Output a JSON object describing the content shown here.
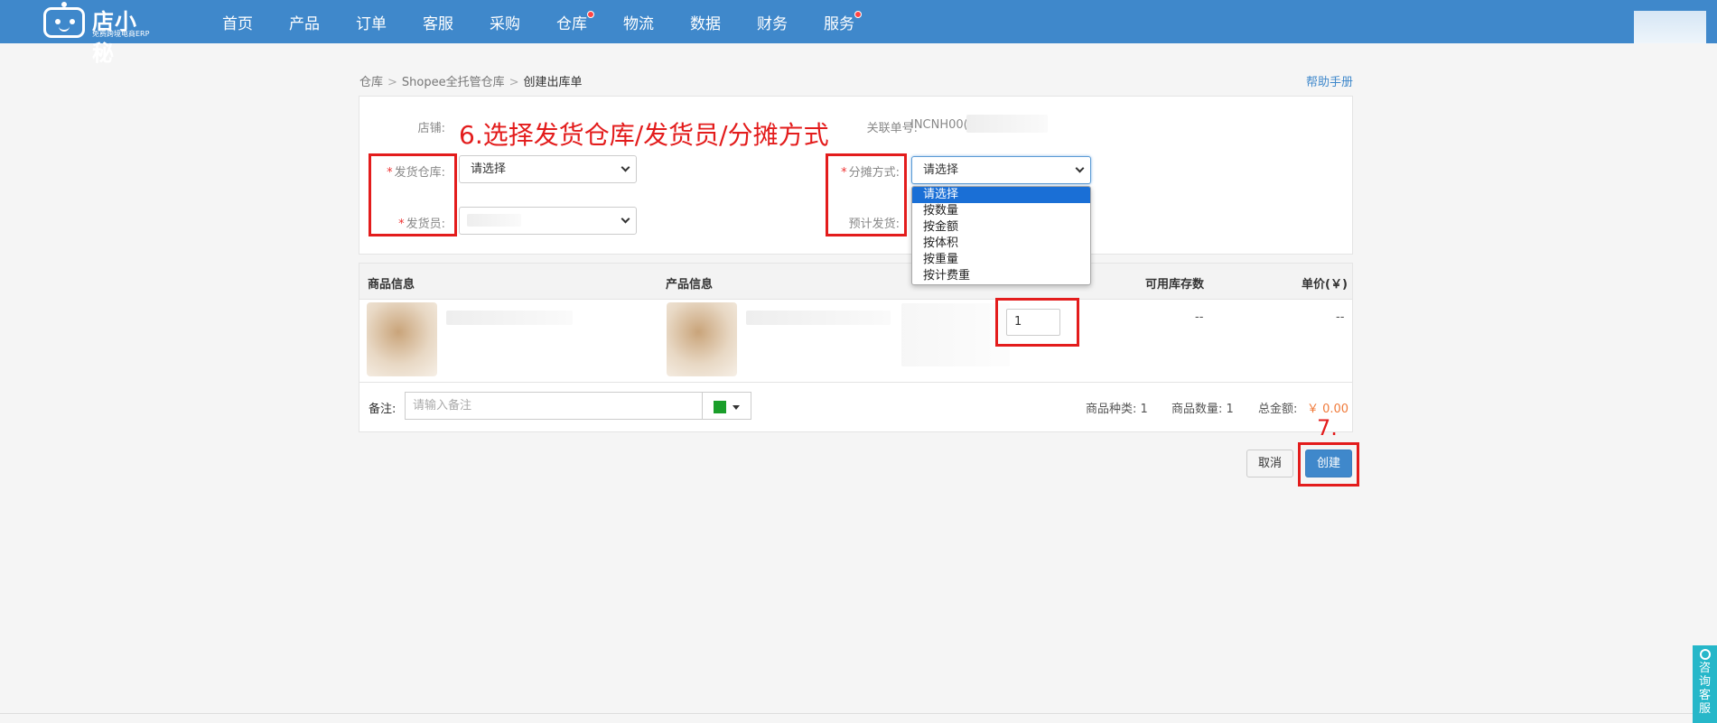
{
  "brand": {
    "name": "店小秘",
    "tagline": "免费跨境电商ERP"
  },
  "nav": [
    {
      "label": "首页",
      "dot": false
    },
    {
      "label": "产品",
      "dot": false
    },
    {
      "label": "订单",
      "dot": false
    },
    {
      "label": "客服",
      "dot": false
    },
    {
      "label": "采购",
      "dot": false
    },
    {
      "label": "仓库",
      "dot": true
    },
    {
      "label": "物流",
      "dot": false
    },
    {
      "label": "数据",
      "dot": false
    },
    {
      "label": "财务",
      "dot": false
    },
    {
      "label": "服务",
      "dot": true
    }
  ],
  "breadcrumb": {
    "items": [
      "仓库",
      "Shopee全托管仓库"
    ],
    "separator": ">",
    "current": "创建出库单"
  },
  "help_link": "帮助手册",
  "form": {
    "shop_label": "店铺:",
    "related_no_label": "关联单号:",
    "related_no_value": "INCNH00(",
    "warehouse_label": "发货仓库:",
    "warehouse_value": "请选择",
    "shipper_label": "发货员:",
    "allocation_label": "分摊方式:",
    "allocation_value": "请选择",
    "est_ship_label": "预计发货:",
    "required_mark": "*"
  },
  "allocation_options": [
    {
      "label": "请选择",
      "active": true
    },
    {
      "label": "按数量",
      "active": false
    },
    {
      "label": "按金额",
      "active": false
    },
    {
      "label": "按体积",
      "active": false
    },
    {
      "label": "按重量",
      "active": false
    },
    {
      "label": "按计费重",
      "active": false
    }
  ],
  "annotations": {
    "step6": "6.选择发货仓库/发货员/分摊方式",
    "step7": "7."
  },
  "table": {
    "headers": {
      "goods": "商品信息",
      "product": "产品信息",
      "available": "可用库存数",
      "price": "单价(￥)"
    },
    "row": {
      "quantity": "1",
      "available": "--",
      "price": "--"
    }
  },
  "footer": {
    "remark_label": "备注:",
    "remark_placeholder": "请输入备注",
    "color_tag": "#1a9e2a",
    "kinds": "商品种类: 1",
    "count": "商品数量: 1",
    "total_label": "总金额:",
    "total_value": "￥ 0.00"
  },
  "actions": {
    "cancel": "取消",
    "create": "创建"
  },
  "side_service": "咨询客服"
}
